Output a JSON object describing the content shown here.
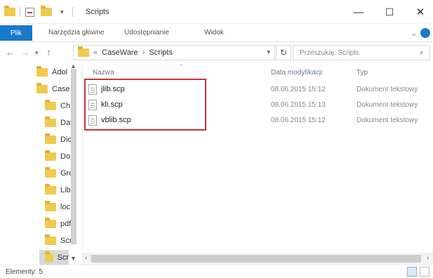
{
  "window": {
    "title": "Scripts",
    "qa_dropdown": "▾",
    "minimize": "—",
    "maximize": "☐",
    "close": "✕"
  },
  "ribbon": {
    "tabs": [
      "Plik",
      "Narzędzia główne",
      "Udostępnianie",
      "Widok"
    ],
    "expand_icon": "chevron-down-icon",
    "help_icon": "help-icon"
  },
  "address": {
    "back": "←",
    "forward": "→",
    "recent": "▾",
    "up": "↑",
    "prefix": "«",
    "crumbs": [
      "CaseWare",
      "Scripts"
    ],
    "separator": "›",
    "dropdown": "▾",
    "refresh": "↻"
  },
  "search": {
    "placeholder": "Przeszukaj: Scripts",
    "icon": "🔍"
  },
  "nav": {
    "items": [
      {
        "label": "Adol",
        "indent": 0,
        "selected": false
      },
      {
        "label": "Case",
        "indent": 0,
        "selected": false
      },
      {
        "label": "Ch",
        "indent": 1,
        "selected": false
      },
      {
        "label": "Dat",
        "indent": 1,
        "selected": false
      },
      {
        "label": "Dic",
        "indent": 1,
        "selected": false
      },
      {
        "label": "Do",
        "indent": 1,
        "selected": false
      },
      {
        "label": "Grc",
        "indent": 1,
        "selected": false
      },
      {
        "label": "Lib",
        "indent": 1,
        "selected": false
      },
      {
        "label": "loc",
        "indent": 1,
        "selected": false
      },
      {
        "label": "pdf",
        "indent": 1,
        "selected": false
      },
      {
        "label": "Scr",
        "indent": 1,
        "selected": false
      },
      {
        "label": "Scr",
        "indent": 1,
        "selected": true
      }
    ],
    "scroll_up": "▲",
    "scroll_down": "▼"
  },
  "columns": {
    "name": "Nazwa",
    "date": "Data modyfikacji",
    "type": "Typ",
    "sort_icon": "^"
  },
  "files": [
    {
      "name": "jlib.scp",
      "date": "08.06.2015 15:12",
      "type": "Dokument tekstowy"
    },
    {
      "name": "kli.scp",
      "date": "08.06.2015 15:13",
      "type": "Dokument tekstowy"
    },
    {
      "name": "vblib.scp",
      "date": "08.06.2015 15:12",
      "type": "Dokument tekstowy"
    }
  ],
  "hscroll": {
    "left": "‹",
    "right": "›"
  },
  "status": {
    "text": "Elementy: 5"
  },
  "colors": {
    "accent": "#1979ca",
    "highlight": "#c8343a",
    "folder": "#f2c94c"
  }
}
